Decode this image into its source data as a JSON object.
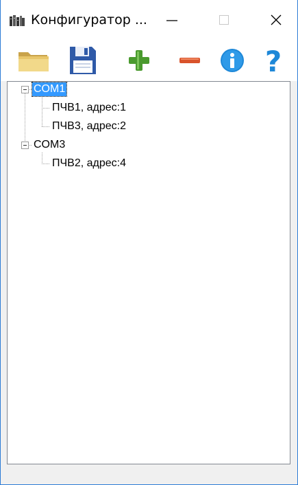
{
  "window": {
    "title": "Конфигуратор ...",
    "minimize_glyph": "—",
    "maximize_glyph": "☐",
    "close_glyph": "✕"
  },
  "toolbar": {
    "items": [
      {
        "name": "open-folder-icon",
        "color": "#e8c66a"
      },
      {
        "name": "save-floppy-icon",
        "color": "#2f5aa8"
      },
      {
        "name": "add-plus-icon",
        "color": "#4a9a2e"
      },
      {
        "name": "remove-minus-icon",
        "color": "#d9532b"
      },
      {
        "name": "info-icon",
        "color": "#1e88d8"
      },
      {
        "name": "help-question-icon",
        "color": "#1e88d8"
      }
    ]
  },
  "tree": {
    "nodes": [
      {
        "label": "COM1",
        "expanded": true,
        "selected": true,
        "children": [
          {
            "label": "ПЧВ1, адрес:1"
          },
          {
            "label": "ПЧВ3, адрес:2"
          }
        ]
      },
      {
        "label": "COM3",
        "expanded": true,
        "selected": false,
        "children": [
          {
            "label": "ПЧВ2, адрес:4"
          }
        ]
      }
    ]
  },
  "colors": {
    "selection": "#3399ff",
    "window_border": "#2b7bd6"
  }
}
